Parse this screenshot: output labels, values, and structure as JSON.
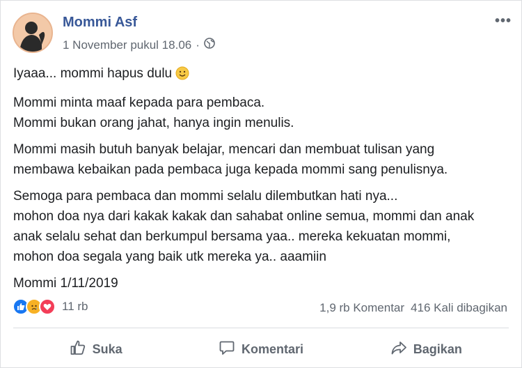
{
  "post": {
    "author": "Mommi Asf",
    "timestamp": "1 November pukul 18.06",
    "privacy_icon": "globe-icon",
    "paragraphs": [
      "Iyaaa... mommi hapus dulu",
      "Mommi minta maaf kepada para pembaca.\nMommi bukan orang jahat, hanya ingin menulis.",
      "Mommi masih butuh banyak belajar, mencari dan membuat tulisan yang\nmembawa kebaikan pada pembaca juga kepada mommi sang penulisnya.",
      "Semoga para pembaca dan mommi selalu dilembutkan hati nya...\nmohon doa nya dari kakak kakak dan sahabat online semua, mommi dan anak\nanak selalu sehat dan berkumpul bersama yaa.. mereka kekuatan mommi,\nmohon doa segala yang baik utk mereka ya.. aaamiin",
      "Mommi 1/11/2019"
    ]
  },
  "reactions": {
    "icons": [
      "like-reaction-icon",
      "sad-reaction-icon",
      "love-reaction-icon"
    ],
    "count": "11 rb"
  },
  "stats": {
    "comments": "1,9 rb Komentar",
    "shares": "416 Kali dibagikan"
  },
  "actions": {
    "like": "Suka",
    "comment": "Komentari",
    "share": "Bagikan"
  },
  "colors": {
    "name": "#385898",
    "like": "#1877f2",
    "love": "#f33e58",
    "sad": "#f7b125"
  }
}
